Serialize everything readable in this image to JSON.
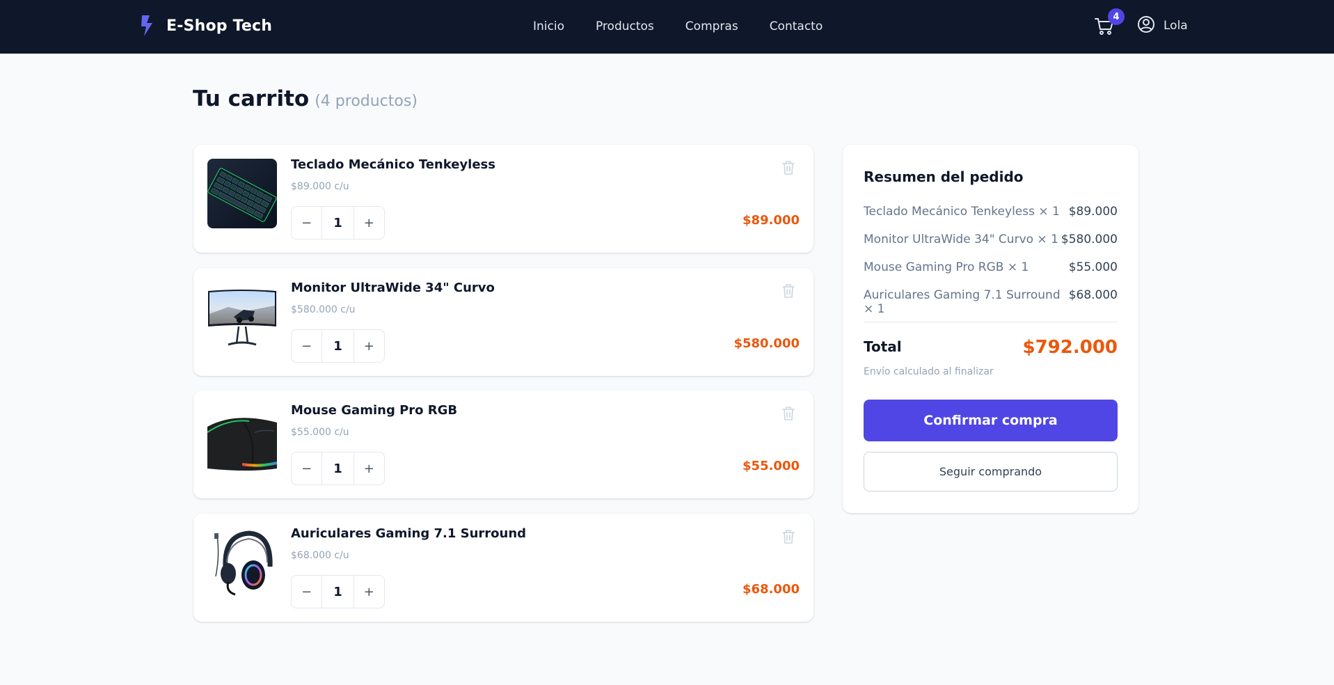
{
  "navbar": {
    "brand": "E-Shop Tech",
    "links": [
      "Inicio",
      "Productos",
      "Compras",
      "Contacto"
    ],
    "cart_count": "4",
    "user_name": "Lola"
  },
  "page": {
    "title": "Tu carrito",
    "count_label": "(4 productos)"
  },
  "items": [
    {
      "name": "Teclado Mecánico Tenkeyless",
      "unit_price": "$89.000 c/u",
      "quantity": "1",
      "total": "$89.000",
      "decrement": "−",
      "increment": "+"
    },
    {
      "name": "Monitor UltraWide 34\" Curvo",
      "unit_price": "$580.000 c/u",
      "quantity": "1",
      "total": "$580.000",
      "decrement": "−",
      "increment": "+"
    },
    {
      "name": "Mouse Gaming Pro RGB",
      "unit_price": "$55.000 c/u",
      "quantity": "1",
      "total": "$55.000",
      "decrement": "−",
      "increment": "+"
    },
    {
      "name": "Auriculares Gaming 7.1 Surround",
      "unit_price": "$68.000 c/u",
      "quantity": "1",
      "total": "$68.000",
      "decrement": "−",
      "increment": "+"
    }
  ],
  "summary": {
    "title": "Resumen del pedido",
    "lines": [
      {
        "label": "Teclado Mecánico Tenkeyless × 1",
        "value": "$89.000"
      },
      {
        "label": "Monitor UltraWide 34\" Curvo × 1",
        "value": "$580.000"
      },
      {
        "label": "Mouse Gaming Pro RGB × 1",
        "value": "$55.000"
      },
      {
        "label": "Auriculares Gaming 7.1 Surround × 1",
        "value": "$68.000"
      }
    ],
    "total_label": "Total",
    "total_value": "$792.000",
    "shipping_note": "Envío calculado al finalizar",
    "confirm_label": "Confirmar compra",
    "continue_label": "Seguir comprando"
  },
  "colors": {
    "navbar_bg": "#0f172a",
    "accent": "#4f46e5",
    "price": "#ea580c",
    "page_bg": "#f8fafc"
  },
  "icons": {
    "brand": "lightning-bolt-icon",
    "cart": "shopping-cart-icon",
    "user": "user-circle-icon",
    "remove": "trash-icon"
  }
}
